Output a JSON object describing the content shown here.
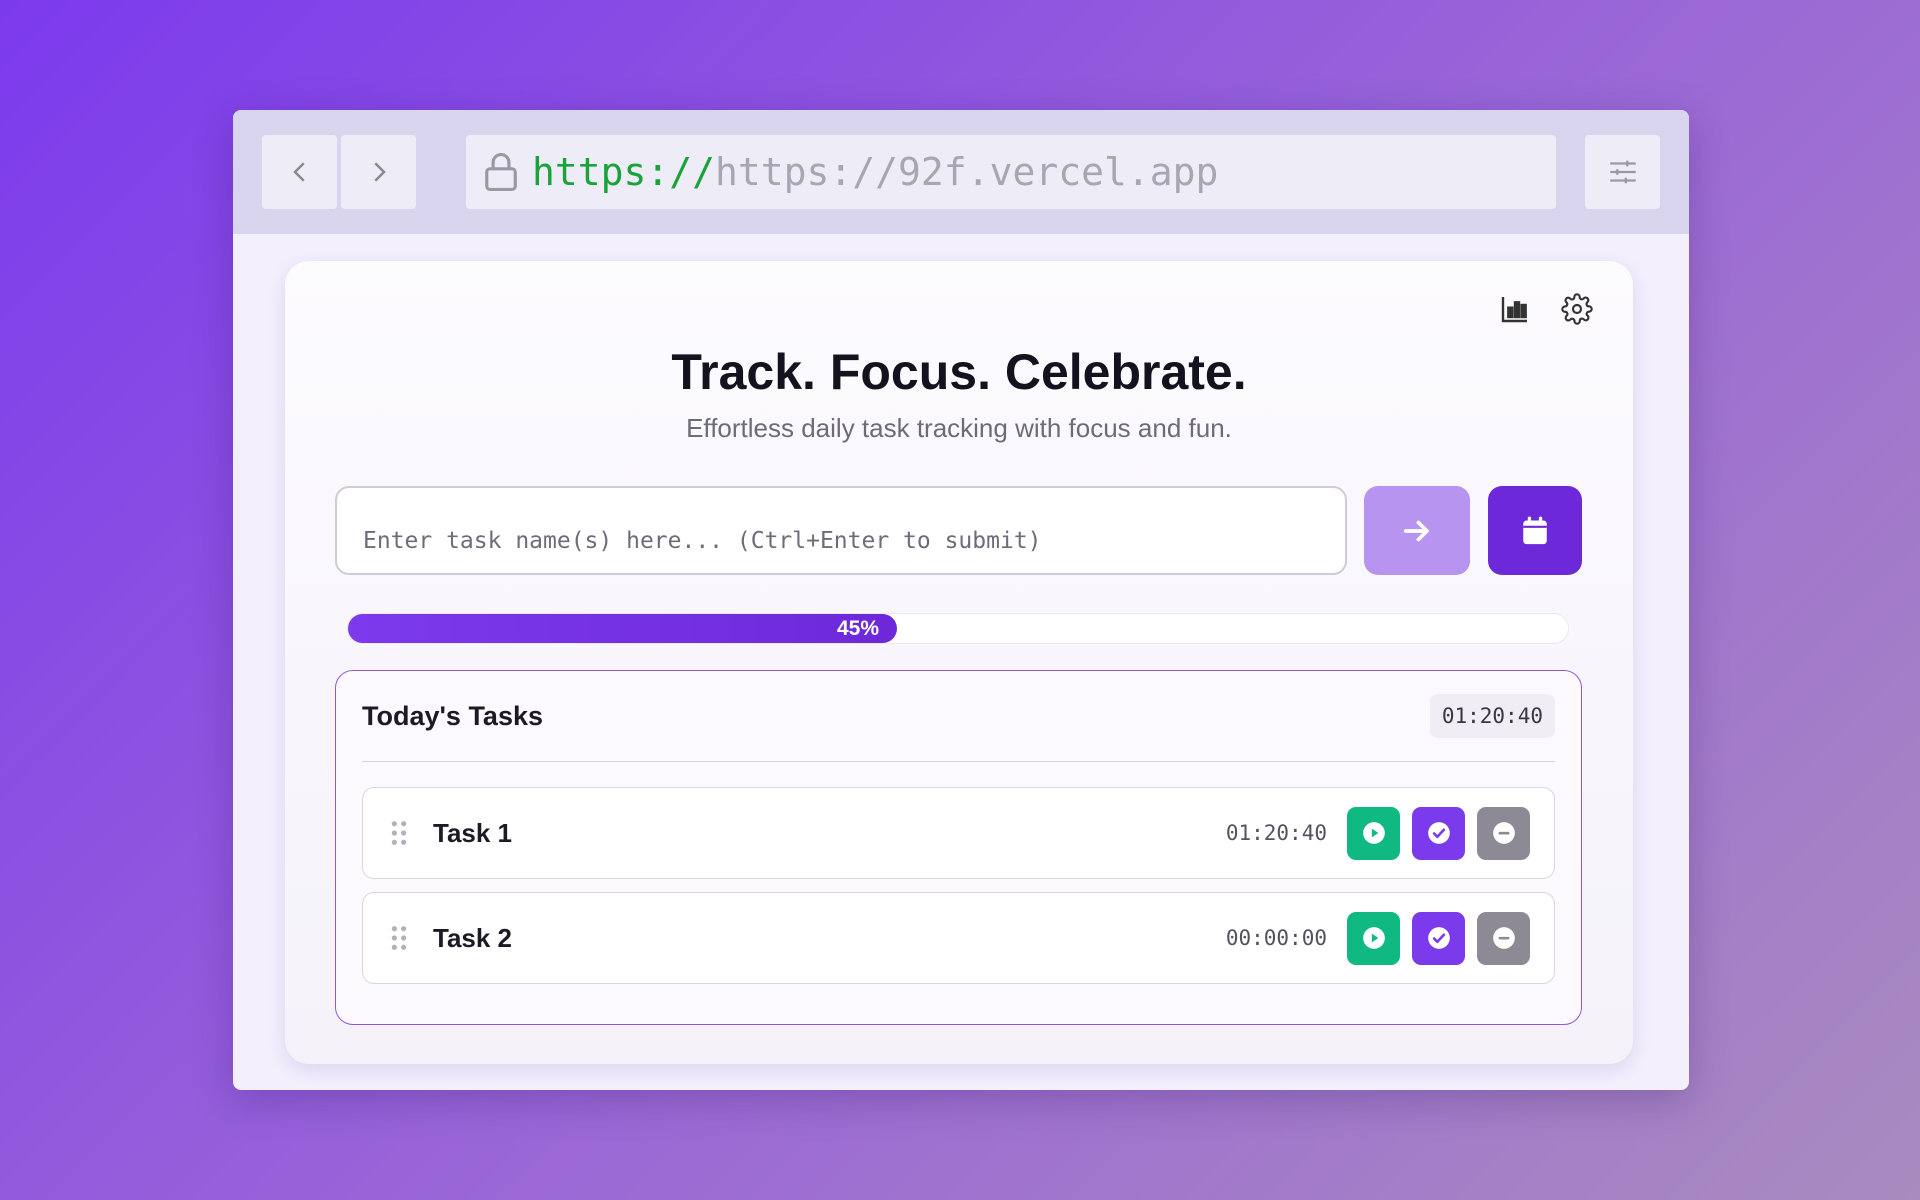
{
  "browser": {
    "url_protocol": "https://",
    "url_host": "https://92f.vercel.app",
    "icons": {
      "back": "chevron-left-icon",
      "forward": "chevron-right-icon",
      "lock": "lock-icon",
      "settings": "sliders-icon"
    }
  },
  "app": {
    "title": "Track. Focus. Celebrate.",
    "subtitle": "Effortless daily task tracking with focus and fun.",
    "header_icons": [
      "bar-chart-icon",
      "gear-icon"
    ],
    "task_input": {
      "value": "",
      "placeholder": "Enter task name(s) here... (Ctrl+Enter to submit)"
    },
    "submit_icon": "arrow-right-icon",
    "calendar_icon": "calendar-icon",
    "progress": {
      "percent": 45,
      "label": "45%"
    },
    "tasks": {
      "title": "Today's Tasks",
      "total_time": "01:20:40",
      "items": [
        {
          "name": "Task 1",
          "time": "01:20:40"
        },
        {
          "name": "Task 2",
          "time": "00:00:00"
        }
      ]
    },
    "colors": {
      "accent": "#7c3aed",
      "play": "#10b981",
      "remove": "#8d8a96",
      "submit_disabled": "#b794ef"
    }
  }
}
